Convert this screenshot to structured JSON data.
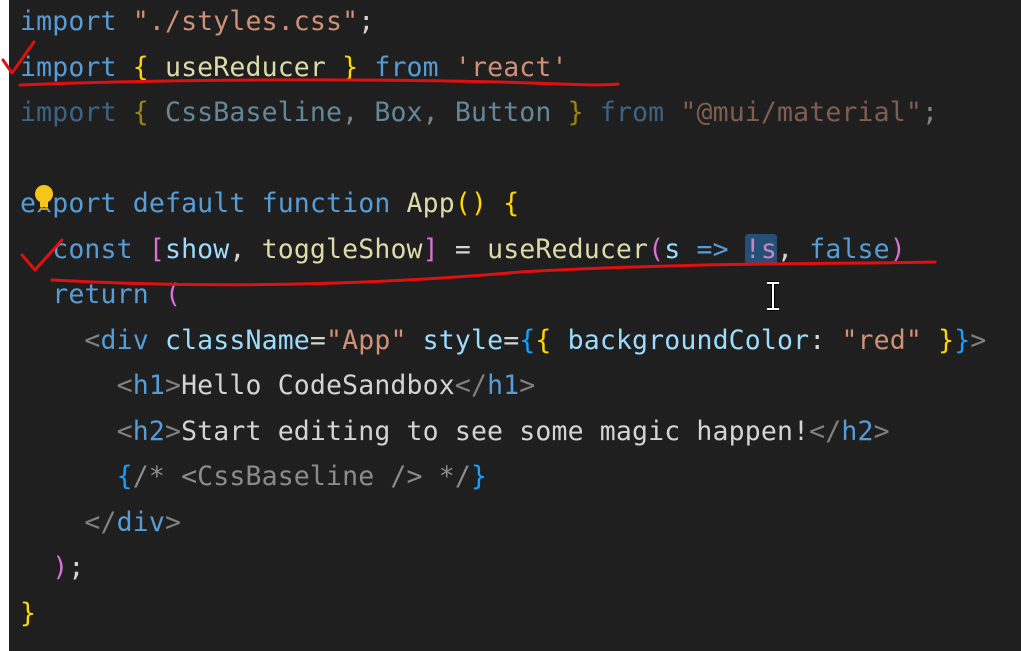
{
  "editor": {
    "lines": [
      {
        "tokens": [
          [
            "kb",
            "import"
          ],
          [
            "txt",
            " "
          ],
          [
            "str",
            "\"./styles.css\""
          ],
          [
            "txt",
            ";"
          ]
        ]
      },
      {
        "tokens": [
          [
            "kb",
            "import"
          ],
          [
            "txt",
            " "
          ],
          [
            "br1",
            "{"
          ],
          [
            "txt",
            " "
          ],
          [
            "fn",
            "useReducer"
          ],
          [
            "txt",
            " "
          ],
          [
            "br1",
            "}"
          ],
          [
            "txt",
            " "
          ],
          [
            "kb",
            "from"
          ],
          [
            "txt",
            " "
          ],
          [
            "str",
            "'react'"
          ]
        ]
      },
      {
        "tokens": [
          [
            "kb",
            "import"
          ],
          [
            "txt",
            " "
          ],
          [
            "br1",
            "{"
          ],
          [
            "txt",
            " "
          ],
          [
            "var",
            "CssBaseline"
          ],
          [
            "txt",
            ", "
          ],
          [
            "var",
            "Box"
          ],
          [
            "txt",
            ", "
          ],
          [
            "var",
            "Button"
          ],
          [
            "txt",
            " "
          ],
          [
            "br1",
            "}"
          ],
          [
            "txt",
            " "
          ],
          [
            "kb",
            "from"
          ],
          [
            "txt",
            " "
          ],
          [
            "str",
            "\"@mui/material\""
          ],
          [
            "txt",
            ";"
          ]
        ],
        "dim": true
      },
      {
        "tokens": []
      },
      {
        "tokens": [
          [
            "kb",
            "export"
          ],
          [
            "txt",
            " "
          ],
          [
            "kb",
            "default"
          ],
          [
            "txt",
            " "
          ],
          [
            "kb",
            "function"
          ],
          [
            "txt",
            " "
          ],
          [
            "fn",
            "App"
          ],
          [
            "br1",
            "()"
          ],
          [
            "txt",
            " "
          ],
          [
            "br1",
            "{"
          ]
        ]
      },
      {
        "tokens": [
          [
            "txt",
            "  "
          ],
          [
            "kb",
            "const"
          ],
          [
            "txt",
            " "
          ],
          [
            "br2",
            "["
          ],
          [
            "var",
            "show"
          ],
          [
            "txt",
            ", "
          ],
          [
            "fn",
            "toggleShow"
          ],
          [
            "br2",
            "]"
          ],
          [
            "txt",
            " = "
          ],
          [
            "fn",
            "useReducer"
          ],
          [
            "br2",
            "("
          ],
          [
            "var",
            "s"
          ],
          [
            "txt",
            " "
          ],
          [
            "kb",
            "=>"
          ],
          [
            "txt",
            " "
          ],
          [
            "sel",
            "!s"
          ],
          [
            "txt",
            ", "
          ],
          [
            "kb",
            "false"
          ],
          [
            "br2",
            ")"
          ]
        ]
      },
      {
        "tokens": [
          [
            "txt",
            "  "
          ],
          [
            "kb",
            "return"
          ],
          [
            "txt",
            " "
          ],
          [
            "br2",
            "("
          ]
        ]
      },
      {
        "tokens": [
          [
            "txt",
            "    "
          ],
          [
            "tagb",
            "<"
          ],
          [
            "tag",
            "div"
          ],
          [
            "txt",
            " "
          ],
          [
            "attr",
            "className"
          ],
          [
            "txt",
            "="
          ],
          [
            "str",
            "\"App\""
          ],
          [
            "txt",
            " "
          ],
          [
            "attr",
            "style"
          ],
          [
            "txt",
            "="
          ],
          [
            "br3",
            "{"
          ],
          [
            "br1",
            "{"
          ],
          [
            "txt",
            " "
          ],
          [
            "attr",
            "backgroundColor"
          ],
          [
            "txt",
            ": "
          ],
          [
            "str",
            "\"red\""
          ],
          [
            "txt",
            " "
          ],
          [
            "br1",
            "}"
          ],
          [
            "br3",
            "}"
          ],
          [
            "tagb",
            ">"
          ]
        ]
      },
      {
        "tokens": [
          [
            "txt",
            "      "
          ],
          [
            "tagb",
            "<"
          ],
          [
            "tag",
            "h1"
          ],
          [
            "tagb",
            ">"
          ],
          [
            "txt",
            "Hello CodeSandbox"
          ],
          [
            "tagb",
            "</"
          ],
          [
            "tag",
            "h1"
          ],
          [
            "tagb",
            ">"
          ]
        ]
      },
      {
        "tokens": [
          [
            "txt",
            "      "
          ],
          [
            "tagb",
            "<"
          ],
          [
            "tag",
            "h2"
          ],
          [
            "tagb",
            ">"
          ],
          [
            "txt",
            "Start editing to see some magic happen!"
          ],
          [
            "tagb",
            "</"
          ],
          [
            "tag",
            "h2"
          ],
          [
            "tagb",
            ">"
          ]
        ]
      },
      {
        "tokens": [
          [
            "txt",
            "      "
          ],
          [
            "br3",
            "{"
          ],
          [
            "cmtg",
            "/* <CssBaseline /> */"
          ],
          [
            "br3",
            "}"
          ]
        ]
      },
      {
        "tokens": [
          [
            "txt",
            "    "
          ],
          [
            "tagb",
            "</"
          ],
          [
            "tag",
            "div"
          ],
          [
            "tagb",
            ">"
          ]
        ]
      },
      {
        "tokens": [
          [
            "txt",
            "  "
          ],
          [
            "br2",
            ")"
          ],
          [
            "txt",
            ";"
          ]
        ]
      },
      {
        "tokens": [
          [
            "br1",
            "}"
          ]
        ]
      }
    ]
  },
  "colors": {
    "background": "#1f1f1f",
    "annotation_ink": "#e01010",
    "selection": "#264f78"
  },
  "icons": {
    "lightbulb": "lightbulb-icon",
    "text_cursor": "i-beam-cursor-icon"
  }
}
